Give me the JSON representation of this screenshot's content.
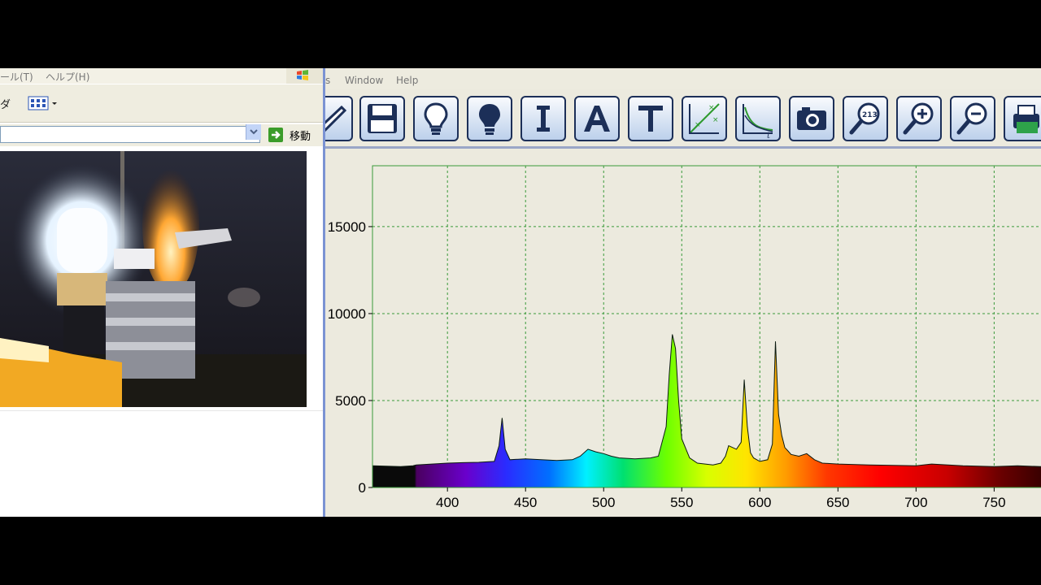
{
  "explorer": {
    "menu": {
      "tools": "ール(T)",
      "help": "ヘルプ(H)"
    },
    "toolbar": {
      "folder_label": "ダ"
    },
    "address": {
      "value": "",
      "go_label": "移動"
    }
  },
  "spectrum_app": {
    "menu": {
      "partial": "s",
      "window": "Window",
      "help": "Help"
    },
    "toolbar": {
      "buttons": [
        "open-partial",
        "save",
        "bulb-light",
        "bulb-dark",
        "I",
        "A",
        "T",
        "cross-plot",
        "decay-time",
        "camera",
        "zoom-213",
        "zoom-in",
        "zoom-out",
        "print"
      ]
    }
  },
  "chart_data": {
    "type": "area",
    "xlabel": "",
    "ylabel": "",
    "xlim": [
      352,
      780
    ],
    "ylim": [
      0,
      18500
    ],
    "x_ticks": [
      400,
      450,
      500,
      550,
      600,
      650,
      700,
      750
    ],
    "y_ticks": [
      0,
      5000,
      10000,
      15000
    ],
    "grid": true,
    "plot_color": "#3a9a3a",
    "fill": "visible-spectrum-gradient",
    "series": [
      {
        "x": [
          352,
          370,
          378,
          380,
          390,
          400,
          410,
          420,
          430,
          433,
          435,
          437,
          440,
          450,
          460,
          470,
          480,
          485,
          490,
          495,
          500,
          505,
          510,
          520,
          530,
          535,
          540,
          542,
          544,
          546,
          548,
          550,
          555,
          560,
          570,
          575,
          578,
          580,
          585,
          588,
          590,
          592,
          594,
          596,
          600,
          605,
          608,
          610,
          612,
          614,
          616,
          618,
          620,
          625,
          630,
          635,
          640,
          650,
          670,
          700,
          710,
          730,
          750,
          765,
          780
        ],
        "y": [
          1250,
          1200,
          1250,
          1300,
          1350,
          1400,
          1430,
          1450,
          1500,
          2400,
          4000,
          2200,
          1600,
          1650,
          1600,
          1550,
          1600,
          1800,
          2200,
          2050,
          1950,
          1800,
          1700,
          1650,
          1700,
          1800,
          3500,
          6500,
          8800,
          8000,
          5000,
          2800,
          1700,
          1400,
          1300,
          1400,
          1800,
          2400,
          2200,
          2600,
          6200,
          3500,
          2000,
          1700,
          1500,
          1600,
          2500,
          8400,
          4200,
          3000,
          2300,
          2100,
          1900,
          1800,
          1950,
          1600,
          1400,
          1350,
          1300,
          1250,
          1350,
          1250,
          1200,
          1250,
          1200
        ]
      }
    ]
  }
}
